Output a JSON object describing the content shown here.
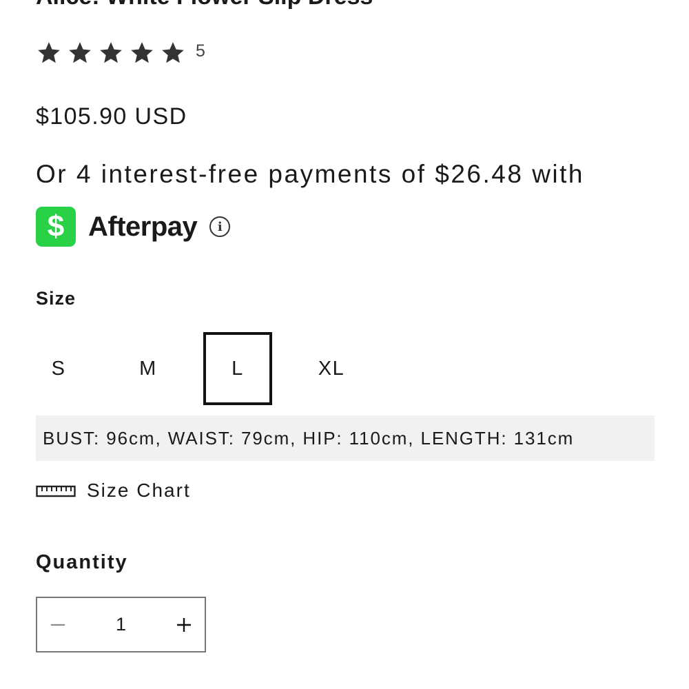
{
  "product": {
    "title": "Alice: White Flower Slip Dress",
    "rating_count": "5",
    "rating_value": 5,
    "rating_max": 5,
    "price": "$105.90 USD"
  },
  "afterpay": {
    "installment_text": "Or 4 interest-free payments of $26.48 with",
    "logo_symbol": "$",
    "name": "Afterpay",
    "info_icon": "info-icon",
    "brand_color": "#28d146"
  },
  "size": {
    "label": "Size",
    "options": [
      "S",
      "M",
      "L",
      "XL"
    ],
    "selected": "L",
    "measurements": "BUST: 96cm, WAIST: 79cm, HIP: 110cm, LENGTH: 131cm",
    "chart_label": "Size Chart",
    "chart_icon": "ruler-icon"
  },
  "quantity": {
    "label": "Quantity",
    "value": "1",
    "decrease_icon": "minus-icon",
    "increase_icon": "plus-icon"
  }
}
